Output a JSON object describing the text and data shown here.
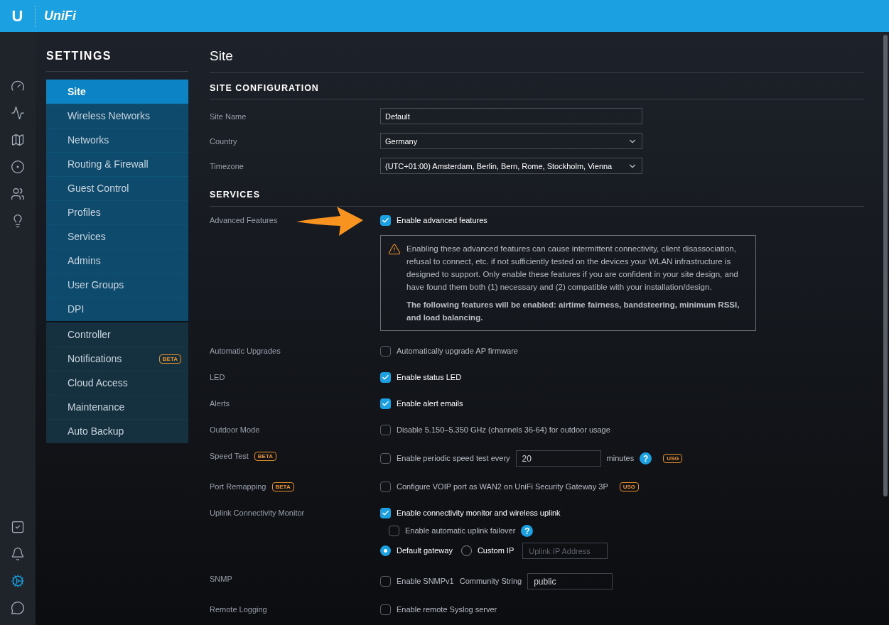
{
  "header": {
    "logo_mark": "U",
    "brand": "UniFi"
  },
  "rail": {
    "top": [
      {
        "selected": false
      },
      {
        "selected": false
      },
      {
        "selected": false
      },
      {
        "selected": false
      },
      {
        "selected": false
      },
      {
        "selected": false
      }
    ],
    "bottom": [
      {
        "selected": false
      },
      {
        "selected": false
      },
      {
        "selected": true
      },
      {
        "selected": false
      }
    ]
  },
  "sidebar": {
    "title": "SETTINGS",
    "groups": [
      [
        {
          "label": "Site",
          "selected": true
        },
        {
          "label": "Wireless Networks",
          "selected": false
        },
        {
          "label": "Networks",
          "selected": false
        },
        {
          "label": "Routing & Firewall",
          "selected": false
        },
        {
          "label": "Guest Control",
          "selected": false
        },
        {
          "label": "Profiles",
          "selected": false
        },
        {
          "label": "Services",
          "selected": false
        },
        {
          "label": "Admins",
          "selected": false
        },
        {
          "label": "User Groups",
          "selected": false
        },
        {
          "label": "DPI",
          "selected": false
        }
      ],
      [
        {
          "label": "Controller",
          "selected": false
        },
        {
          "label": "Notifications",
          "badge": "BETA",
          "selected": false
        },
        {
          "label": "Cloud Access",
          "selected": false
        },
        {
          "label": "Maintenance",
          "selected": false
        },
        {
          "label": "Auto Backup",
          "selected": false
        }
      ]
    ]
  },
  "page_title": "Site",
  "site_configuration": {
    "heading": "SITE CONFIGURATION",
    "fields": [
      {
        "kind": "text",
        "label": "Site Name",
        "value": "Default"
      },
      {
        "kind": "select",
        "label": "Country",
        "value": "Germany"
      },
      {
        "kind": "select",
        "label": "Timezone",
        "value": "(UTC+01:00) Amsterdam, Berlin, Bern, Rome, Stockholm, Vienna"
      }
    ]
  },
  "services": {
    "heading": "SERVICES",
    "rows": [
      {
        "label": "Advanced Features",
        "pointer": true,
        "lines": [
          [
            {
              "kind": "checkbox",
              "checked": true,
              "label": "Enable advanced features"
            }
          ],
          [
            {
              "kind": "notice",
              "paragraphs": [
                "Enabling these advanced features can cause intermittent connectivity, client disassociation, refusal to connect, etc. if not sufficiently tested on the devices your WLAN infrastructure is designed to support. Only enable these features if you are confident in your site design, and have found them both (1) necessary and (2) compatible with your installation/design.",
                "The following features will be enabled: airtime fairness, bandsteering, minimum RSSI, and load balancing."
              ]
            }
          ]
        ]
      },
      {
        "label": "Automatic Upgrades",
        "lines": [
          [
            {
              "kind": "checkbox",
              "checked": false,
              "label": "Automatically upgrade AP firmware"
            }
          ]
        ]
      },
      {
        "label": "LED",
        "lines": [
          [
            {
              "kind": "checkbox",
              "checked": true,
              "label": "Enable status LED"
            }
          ]
        ]
      },
      {
        "label": "Alerts",
        "lines": [
          [
            {
              "kind": "checkbox",
              "checked": true,
              "label": "Enable alert emails"
            }
          ]
        ]
      },
      {
        "label": "Outdoor Mode",
        "lines": [
          [
            {
              "kind": "checkbox",
              "checked": false,
              "label": "Disable 5.150–5.350 GHz (channels 36-64) for outdoor usage"
            }
          ]
        ]
      },
      {
        "label": "Speed Test",
        "badge": "BETA",
        "lines": [
          [
            {
              "kind": "checkbox",
              "checked": false,
              "label": "Enable periodic speed test every"
            },
            {
              "kind": "input",
              "value": "20"
            },
            {
              "kind": "text",
              "text": "minutes"
            },
            {
              "kind": "help",
              "text": "?"
            },
            {
              "kind": "badge",
              "text": "USG"
            }
          ]
        ]
      },
      {
        "label": "Port Remapping",
        "badge": "BETA",
        "lines": [
          [
            {
              "kind": "checkbox",
              "checked": false,
              "label": "Configure VOIP port as WAN2 on UniFi Security Gateway 3P"
            },
            {
              "kind": "badge",
              "text": "USG"
            }
          ]
        ]
      },
      {
        "label": "Uplink Connectivity Monitor",
        "lines": [
          [
            {
              "kind": "checkbox",
              "checked": true,
              "label": "Enable connectivity monitor and wireless uplink"
            }
          ],
          [
            {
              "kind": "subcheckbox",
              "checked": false,
              "label": "Enable automatic uplink failover"
            },
            {
              "kind": "help",
              "text": "?"
            }
          ],
          [
            {
              "kind": "radio",
              "selected": true,
              "label": "Default gateway"
            },
            {
              "kind": "radio",
              "selected": false,
              "label": "Custom IP"
            },
            {
              "kind": "input",
              "placeholder": "Uplink IP Address"
            }
          ]
        ]
      },
      {
        "label": "SNMP",
        "lines": [
          [
            {
              "kind": "checkbox",
              "checked": false,
              "label": "Enable SNMPv1"
            },
            {
              "kind": "text",
              "text": "Community String"
            },
            {
              "kind": "input",
              "value": "public"
            }
          ]
        ]
      },
      {
        "label": "Remote Logging",
        "lines": [
          [
            {
              "kind": "checkbox",
              "checked": false,
              "label": "Enable remote Syslog server"
            }
          ]
        ]
      }
    ]
  }
}
